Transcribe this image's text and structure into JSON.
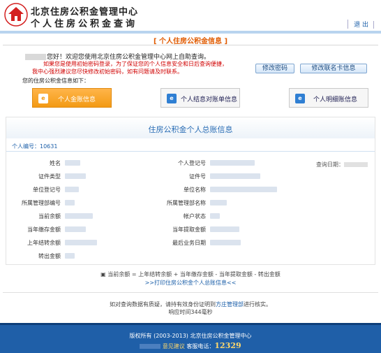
{
  "header": {
    "org_name": "北京住房公积金管理中心",
    "org_subtitle": "个人住房公积金查询",
    "logout_label": "退 出"
  },
  "section_title": "[ 个人住房公积金信息 ]",
  "welcome": {
    "greeting": "您好！欢迎您使用北京住房公积金管理中心网上自助查询。",
    "warning_line1": "如果您是使用初始密码登录，为了保证您的个人信息安全和日后查询便捷，",
    "warning_line2": "我中心强烈建议您尽快修改初始密码，如有问题请及时联系。",
    "info_note": "您的住房公积金信息如下：",
    "change_password_label": "修改密码",
    "change_card_label": "修改联名卡信息"
  },
  "nav_buttons": {
    "overview_label": "个人金账信息",
    "settlement_label": "个人结息对账单信息",
    "detail_label": "个人明细账信息"
  },
  "panel": {
    "title": "住房公积金个人总账信息",
    "account_no_label": "个人编号：",
    "account_no_value": "10631",
    "query_date_label": "查询日期：",
    "left_fields": [
      "姓名",
      "证件类型",
      "单位登记号",
      "所属管理部编号",
      "当前余额",
      "当年缴存金额",
      "上年结转余额",
      "转出金额"
    ],
    "right_fields": [
      "个人登记号",
      "证件号",
      "单位名称",
      "所属管理部名称",
      "帐户状态",
      "当年提取金额",
      "最后业务日期"
    ]
  },
  "footer_notes": {
    "formula": "当前余额 = 上年结转余额 + 当年缴存金额 - 当年提取金额 - 转出金额",
    "print_link": ">>打印住房公积金个人总账信息<<",
    "verify_pre": "如对查询数据有质疑，请持有效身份证明到",
    "verify_link": "方庄管理部",
    "verify_post": "进行核实。",
    "response_time": "响应时间344毫秒"
  },
  "footer": {
    "copyright": "版权所有 (2003-2013) 北京住房公积金管理中心",
    "feedback_label": "意见建议",
    "hotline_label": "客服电话：",
    "hotline_number": "12329"
  },
  "colors": {
    "accent": "#1f5fa8",
    "title_orange": "#e05a00",
    "warning_red": "#d00000",
    "primary_button": "#f39a14"
  }
}
